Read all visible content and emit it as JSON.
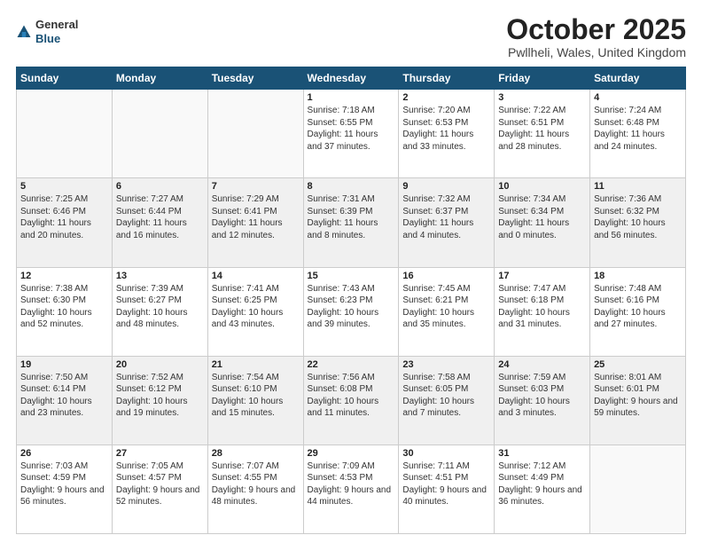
{
  "header": {
    "logo_general": "General",
    "logo_blue": "Blue",
    "title": "October 2025",
    "subtitle": "Pwllheli, Wales, United Kingdom"
  },
  "weekdays": [
    "Sunday",
    "Monday",
    "Tuesday",
    "Wednesday",
    "Thursday",
    "Friday",
    "Saturday"
  ],
  "weeks": [
    [
      {
        "day": "",
        "text": ""
      },
      {
        "day": "",
        "text": ""
      },
      {
        "day": "",
        "text": ""
      },
      {
        "day": "1",
        "text": "Sunrise: 7:18 AM\nSunset: 6:55 PM\nDaylight: 11 hours and 37 minutes."
      },
      {
        "day": "2",
        "text": "Sunrise: 7:20 AM\nSunset: 6:53 PM\nDaylight: 11 hours and 33 minutes."
      },
      {
        "day": "3",
        "text": "Sunrise: 7:22 AM\nSunset: 6:51 PM\nDaylight: 11 hours and 28 minutes."
      },
      {
        "day": "4",
        "text": "Sunrise: 7:24 AM\nSunset: 6:48 PM\nDaylight: 11 hours and 24 minutes."
      }
    ],
    [
      {
        "day": "5",
        "text": "Sunrise: 7:25 AM\nSunset: 6:46 PM\nDaylight: 11 hours and 20 minutes."
      },
      {
        "day": "6",
        "text": "Sunrise: 7:27 AM\nSunset: 6:44 PM\nDaylight: 11 hours and 16 minutes."
      },
      {
        "day": "7",
        "text": "Sunrise: 7:29 AM\nSunset: 6:41 PM\nDaylight: 11 hours and 12 minutes."
      },
      {
        "day": "8",
        "text": "Sunrise: 7:31 AM\nSunset: 6:39 PM\nDaylight: 11 hours and 8 minutes."
      },
      {
        "day": "9",
        "text": "Sunrise: 7:32 AM\nSunset: 6:37 PM\nDaylight: 11 hours and 4 minutes."
      },
      {
        "day": "10",
        "text": "Sunrise: 7:34 AM\nSunset: 6:34 PM\nDaylight: 11 hours and 0 minutes."
      },
      {
        "day": "11",
        "text": "Sunrise: 7:36 AM\nSunset: 6:32 PM\nDaylight: 10 hours and 56 minutes."
      }
    ],
    [
      {
        "day": "12",
        "text": "Sunrise: 7:38 AM\nSunset: 6:30 PM\nDaylight: 10 hours and 52 minutes."
      },
      {
        "day": "13",
        "text": "Sunrise: 7:39 AM\nSunset: 6:27 PM\nDaylight: 10 hours and 48 minutes."
      },
      {
        "day": "14",
        "text": "Sunrise: 7:41 AM\nSunset: 6:25 PM\nDaylight: 10 hours and 43 minutes."
      },
      {
        "day": "15",
        "text": "Sunrise: 7:43 AM\nSunset: 6:23 PM\nDaylight: 10 hours and 39 minutes."
      },
      {
        "day": "16",
        "text": "Sunrise: 7:45 AM\nSunset: 6:21 PM\nDaylight: 10 hours and 35 minutes."
      },
      {
        "day": "17",
        "text": "Sunrise: 7:47 AM\nSunset: 6:18 PM\nDaylight: 10 hours and 31 minutes."
      },
      {
        "day": "18",
        "text": "Sunrise: 7:48 AM\nSunset: 6:16 PM\nDaylight: 10 hours and 27 minutes."
      }
    ],
    [
      {
        "day": "19",
        "text": "Sunrise: 7:50 AM\nSunset: 6:14 PM\nDaylight: 10 hours and 23 minutes."
      },
      {
        "day": "20",
        "text": "Sunrise: 7:52 AM\nSunset: 6:12 PM\nDaylight: 10 hours and 19 minutes."
      },
      {
        "day": "21",
        "text": "Sunrise: 7:54 AM\nSunset: 6:10 PM\nDaylight: 10 hours and 15 minutes."
      },
      {
        "day": "22",
        "text": "Sunrise: 7:56 AM\nSunset: 6:08 PM\nDaylight: 10 hours and 11 minutes."
      },
      {
        "day": "23",
        "text": "Sunrise: 7:58 AM\nSunset: 6:05 PM\nDaylight: 10 hours and 7 minutes."
      },
      {
        "day": "24",
        "text": "Sunrise: 7:59 AM\nSunset: 6:03 PM\nDaylight: 10 hours and 3 minutes."
      },
      {
        "day": "25",
        "text": "Sunrise: 8:01 AM\nSunset: 6:01 PM\nDaylight: 9 hours and 59 minutes."
      }
    ],
    [
      {
        "day": "26",
        "text": "Sunrise: 7:03 AM\nSunset: 4:59 PM\nDaylight: 9 hours and 56 minutes."
      },
      {
        "day": "27",
        "text": "Sunrise: 7:05 AM\nSunset: 4:57 PM\nDaylight: 9 hours and 52 minutes."
      },
      {
        "day": "28",
        "text": "Sunrise: 7:07 AM\nSunset: 4:55 PM\nDaylight: 9 hours and 48 minutes."
      },
      {
        "day": "29",
        "text": "Sunrise: 7:09 AM\nSunset: 4:53 PM\nDaylight: 9 hours and 44 minutes."
      },
      {
        "day": "30",
        "text": "Sunrise: 7:11 AM\nSunset: 4:51 PM\nDaylight: 9 hours and 40 minutes."
      },
      {
        "day": "31",
        "text": "Sunrise: 7:12 AM\nSunset: 4:49 PM\nDaylight: 9 hours and 36 minutes."
      },
      {
        "day": "",
        "text": ""
      }
    ]
  ]
}
